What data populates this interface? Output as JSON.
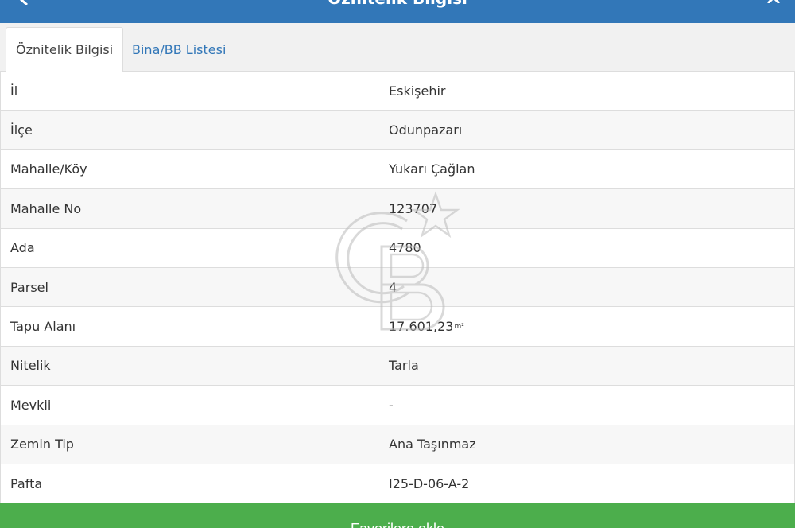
{
  "header": {
    "title": "Öznitelik Bilgisi"
  },
  "tabs": [
    {
      "label": "Öznitelik Bilgisi",
      "active": true
    },
    {
      "label": "Bina/BB Listesi",
      "active": false
    }
  ],
  "rows": [
    {
      "label": "İl",
      "value": "Eskişehir"
    },
    {
      "label": "İlçe",
      "value": "Odunpazarı"
    },
    {
      "label": "Mahalle/Köy",
      "value": "Yukarı Çağlan"
    },
    {
      "label": "Mahalle No",
      "value": "123707"
    },
    {
      "label": "Ada",
      "value": "4780"
    },
    {
      "label": "Parsel",
      "value": "4"
    },
    {
      "label": "Tapu Alanı",
      "value": "17.601,23",
      "unit": "m²"
    },
    {
      "label": "Nitelik",
      "value": "Tarla"
    },
    {
      "label": "Mevkii",
      "value": "-"
    },
    {
      "label": "Zemin Tip",
      "value": "Ana Taşınmaz"
    },
    {
      "label": "Pafta",
      "value": "I25-D-06-A-2"
    }
  ],
  "bottom_button": {
    "label": "Favorilere ekle"
  },
  "colors": {
    "header": "#3277b8",
    "tab_link": "#3277b8",
    "button": "#4cae4c",
    "border": "#dddddd"
  },
  "icons": {
    "header_back": "chevron-left-icon",
    "header_close": "close-icon",
    "watermark": "cb-star-logo"
  }
}
